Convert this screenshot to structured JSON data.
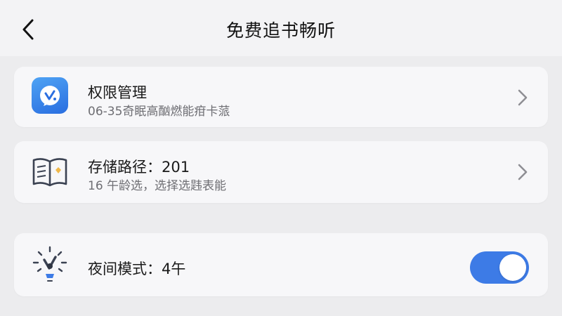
{
  "header": {
    "title": "免费追书畅听",
    "back_icon": "chevron-left-icon"
  },
  "settings": {
    "permission": {
      "icon": "app-logo-icon",
      "title": "权限管理",
      "subtitle": "06-35奇眠高酗燃能疳卡蒎"
    },
    "storage": {
      "icon": "open-book-icon",
      "title": "存储路径：201",
      "subtitle": "16 午龄选，选择选韪表能"
    },
    "night_mode": {
      "icon": "lightbulb-icon",
      "title": "夜间模式：4午",
      "enabled": true
    }
  },
  "colors": {
    "accent": "#3d7be6",
    "background": "#ececee",
    "card": "#f7f7f9"
  }
}
